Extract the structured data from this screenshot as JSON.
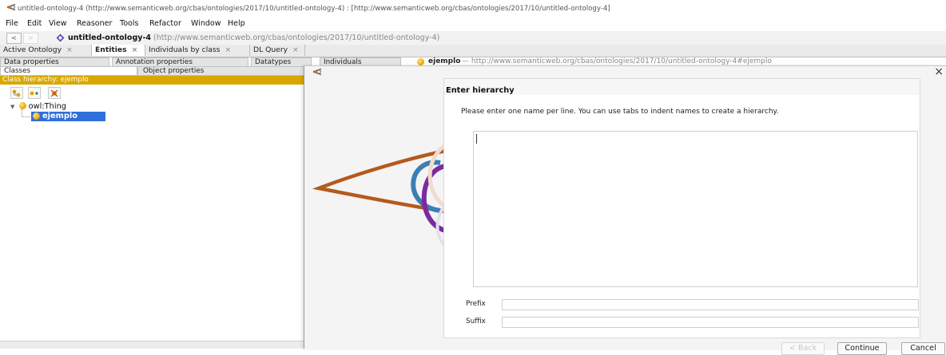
{
  "window": {
    "title": "untitled-ontology-4 (http://www.semanticweb.org/cbas/ontologies/2017/10/untitled-ontology-4) : [http://www.semanticweb.org/cbas/ontologies/2017/10/untitled-ontology-4]"
  },
  "menu": {
    "items": [
      "File",
      "Edit",
      "View",
      "Reasoner",
      "Tools",
      "Refactor",
      "Window",
      "Help"
    ]
  },
  "address": {
    "back": "<",
    "forward": ">",
    "name": "untitled-ontology-4",
    "url": "(http://www.semanticweb.org/cbas/ontologies/2017/10/untitled-ontology-4)"
  },
  "tabs": [
    {
      "label": "Active Ontology",
      "close": "×"
    },
    {
      "label": "Entities",
      "close": "×"
    },
    {
      "label": "Individuals by class",
      "close": "×"
    },
    {
      "label": "DL Query",
      "close": "×"
    }
  ],
  "subtabs": {
    "data_properties": "Data properties",
    "annotation_properties": "Annotation properties",
    "datatypes": "Datatypes",
    "individuals": "Individuals",
    "classes": "Classes",
    "object_properties": "Object properties"
  },
  "hierarchy": {
    "header": "Class hierarchy: ejemplo",
    "root": "owl:Thing",
    "selected": "ejemplo"
  },
  "background_header": {
    "entity": "ejemplo",
    "iri": "— http://www.semanticweb.org/cbas/ontologies/2017/10/untitled-ontology-4#ejemplo"
  },
  "dialog": {
    "close": "×",
    "title": "Enter hierarchy",
    "instructions": "Please enter one name per line.  You can use tabs to indent names to create a hierarchy.",
    "textarea_value": "",
    "prefix_label": "Prefix",
    "prefix_value": "",
    "suffix_label": "Suffix",
    "suffix_value": "",
    "buttons": {
      "back": "< Back",
      "continue": "Continue",
      "cancel": "Cancel"
    }
  },
  "colors": {
    "hierarchy_header": "#d9a700",
    "selection": "#2f6fdb",
    "class_icon": "#e8a300",
    "protege_brown": "#b45a1c",
    "protege_blue": "#3d7fb3",
    "protege_purple": "#7b2aa0"
  }
}
